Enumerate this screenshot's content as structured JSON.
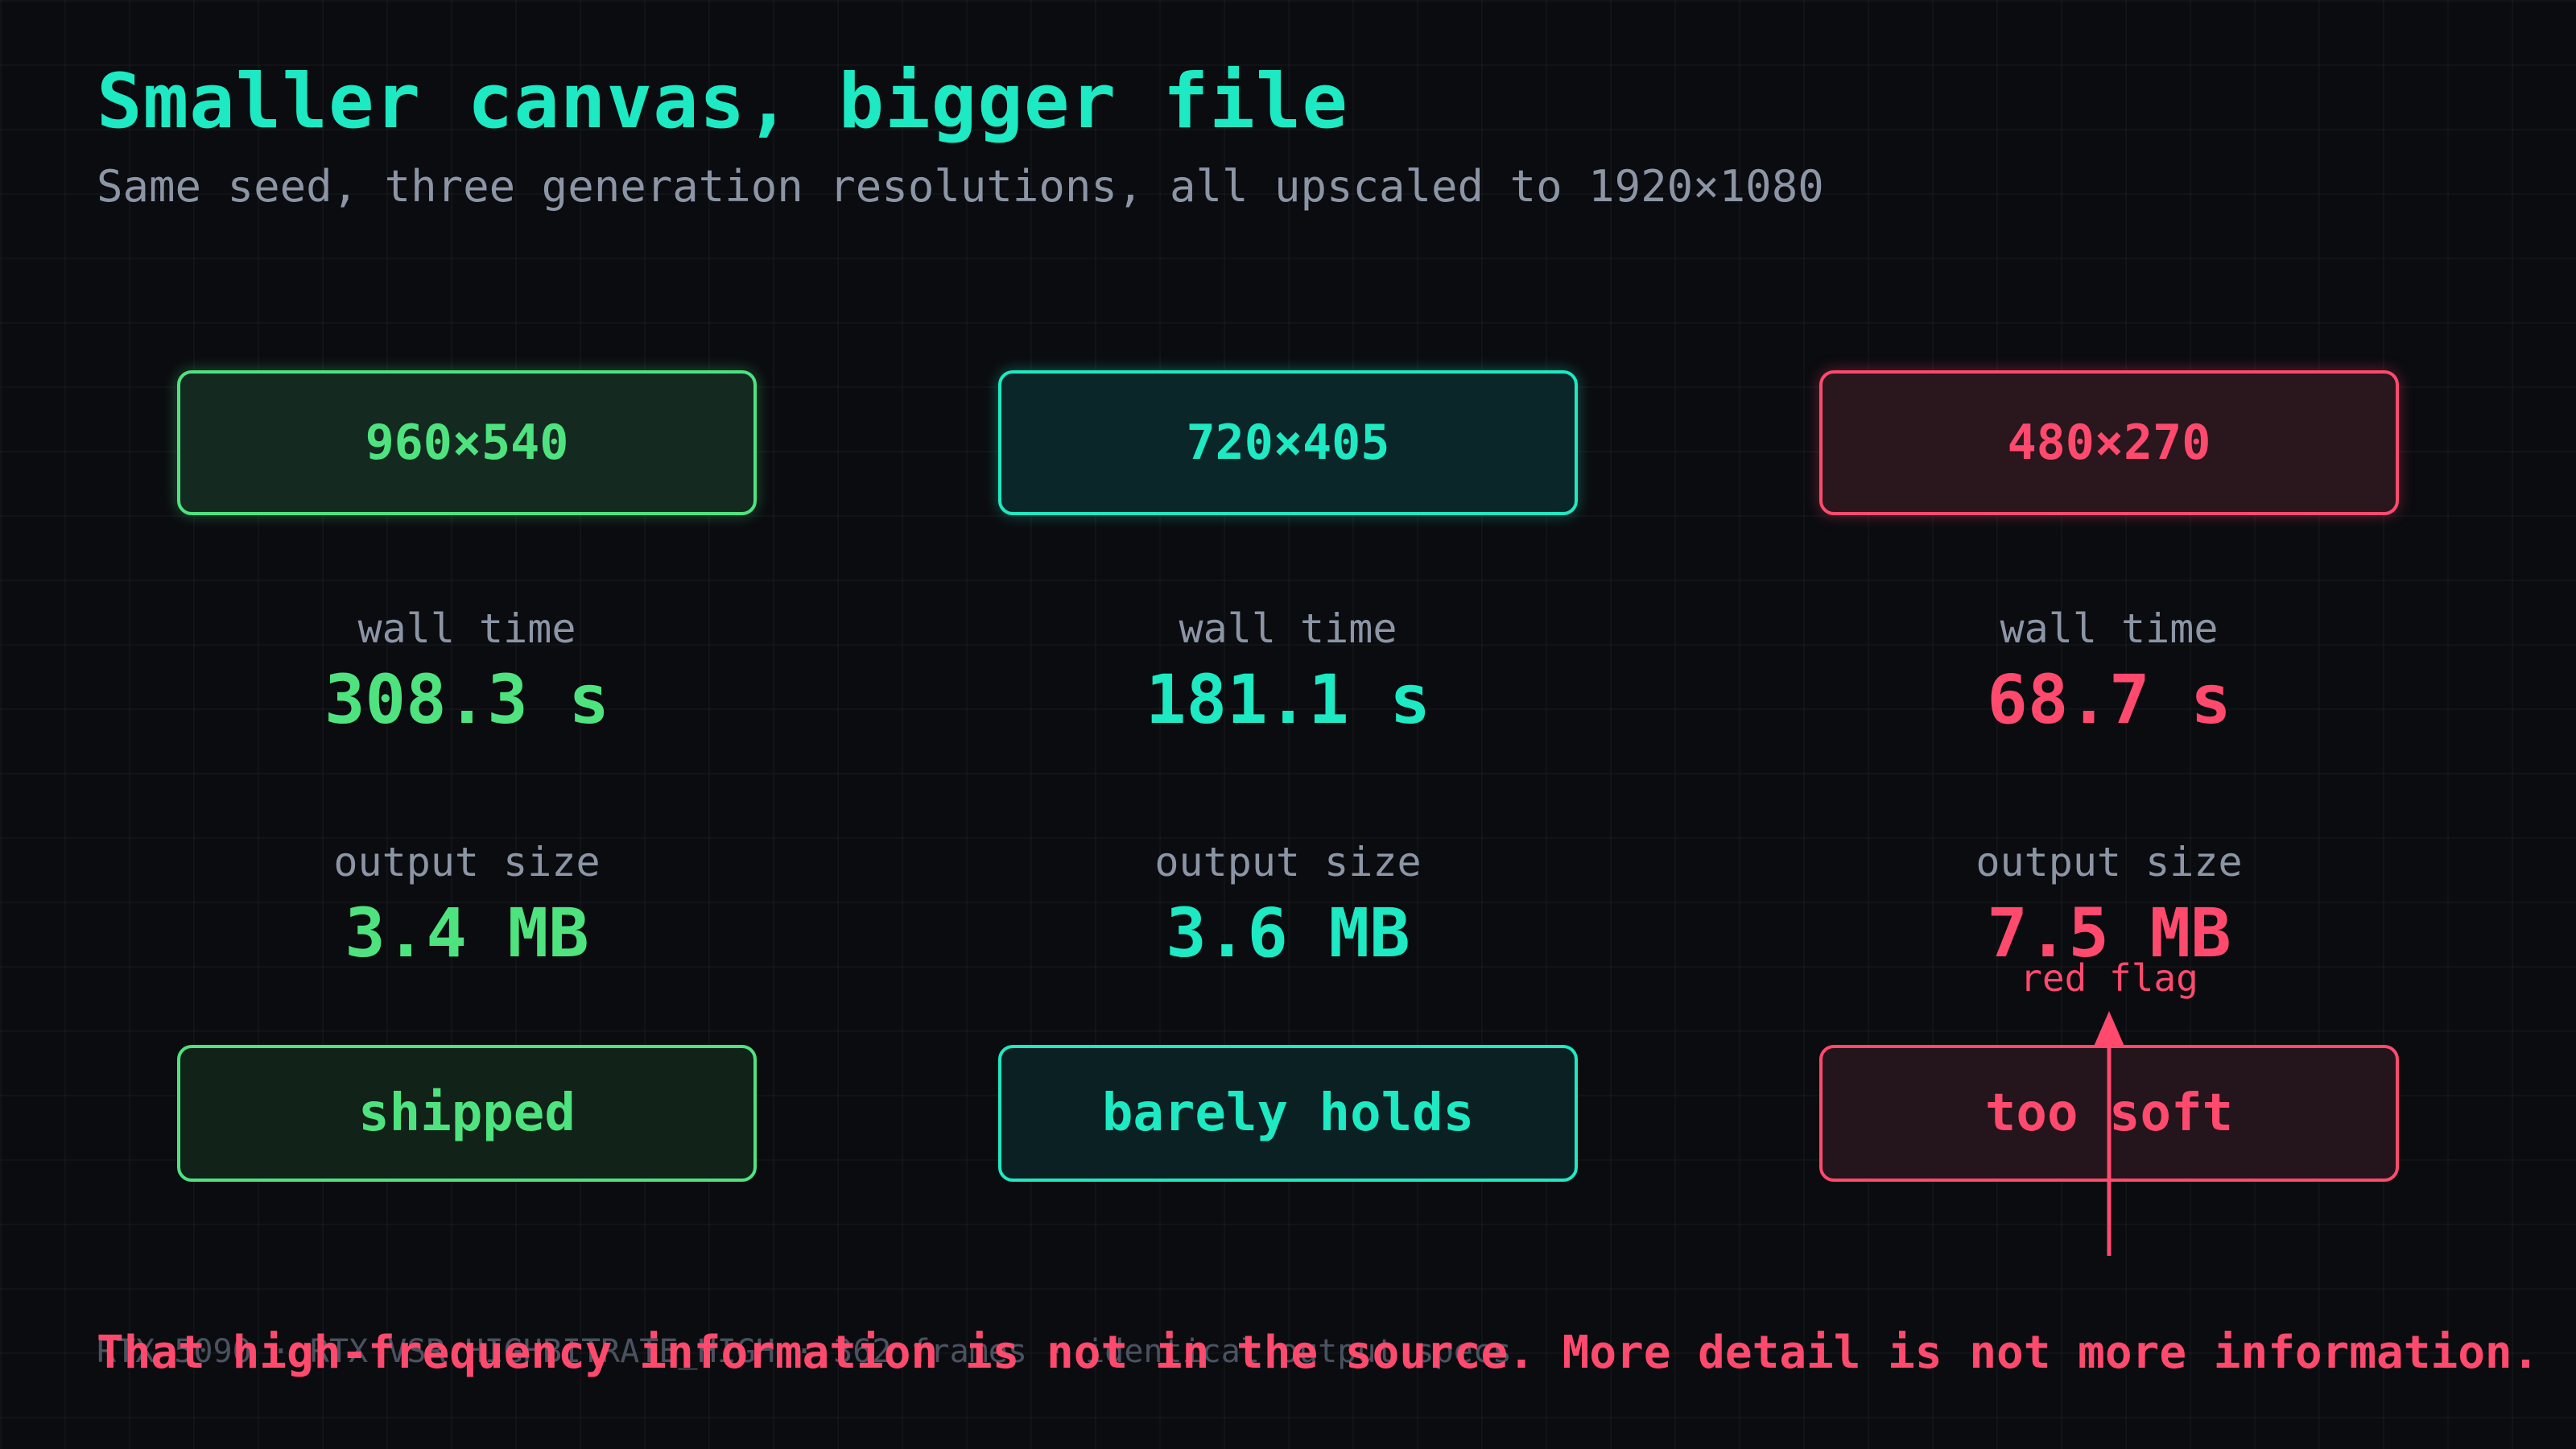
{
  "title": "Smaller canvas, bigger file",
  "subtitle": "Same seed, three generation resolutions, all upscaled to 1920×1080",
  "colors": {
    "background": "#0b0c10",
    "green": "#4ee37f",
    "teal": "#1de9c2",
    "red": "#ff4a6e",
    "muted": "#8b95a5"
  },
  "columns": [
    {
      "resolution": "960×540",
      "wall_time_label": "wall time",
      "wall_time": "308.3 s",
      "output_size_label": "output size",
      "output_size": "3.4 MB",
      "verdict": "shipped",
      "color": "green"
    },
    {
      "resolution": "720×405",
      "wall_time_label": "wall time",
      "wall_time": "181.1 s",
      "output_size_label": "output size",
      "output_size": "3.6 MB",
      "verdict": "barely holds",
      "color": "teal"
    },
    {
      "resolution": "480×270",
      "wall_time_label": "wall time",
      "wall_time": "68.7 s",
      "output_size_label": "output size",
      "output_size": "7.5 MB",
      "verdict": "too soft",
      "color": "red"
    }
  ],
  "annotation": {
    "text": "red flag",
    "icon": "arrow-up-icon"
  },
  "footer": "RTX 5090 · RTX VSR HIGHBITRATE_HIGH · 362 frames · identical output specs",
  "punchline": "That high-frequency information is not in the source. More detail is not more information."
}
